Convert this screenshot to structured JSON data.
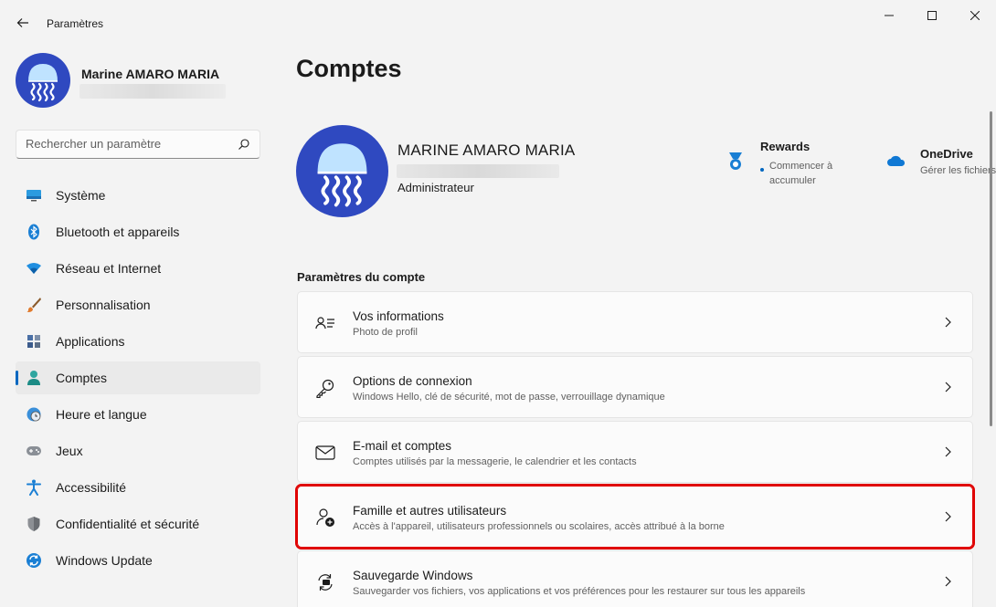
{
  "app": {
    "title": "Paramètres"
  },
  "user": {
    "name": "Marine AMARO MARIA"
  },
  "search": {
    "placeholder": "Rechercher un paramètre"
  },
  "nav": {
    "items": [
      {
        "label": "Système",
        "icon": "monitor-icon"
      },
      {
        "label": "Bluetooth et appareils",
        "icon": "bluetooth-icon"
      },
      {
        "label": "Réseau et Internet",
        "icon": "wifi-icon"
      },
      {
        "label": "Personnalisation",
        "icon": "paintbrush-icon"
      },
      {
        "label": "Applications",
        "icon": "apps-icon"
      },
      {
        "label": "Comptes",
        "icon": "person-icon",
        "active": true
      },
      {
        "label": "Heure et langue",
        "icon": "globe-clock-icon"
      },
      {
        "label": "Jeux",
        "icon": "gamepad-icon"
      },
      {
        "label": "Accessibilité",
        "icon": "accessibility-icon"
      },
      {
        "label": "Confidentialité et sécurité",
        "icon": "shield-icon"
      },
      {
        "label": "Windows Update",
        "icon": "update-icon"
      }
    ]
  },
  "main": {
    "title": "Comptes",
    "profile": {
      "name": "MARINE AMARO MARIA",
      "role": "Administrateur"
    },
    "rewards": {
      "title": "Rewards",
      "subtitle": "Commencer à accumuler"
    },
    "onedrive": {
      "title": "OneDrive",
      "subtitle": "Gérer les fichiers"
    },
    "section_title": "Paramètres du compte",
    "cards": [
      {
        "title": "Vos informations",
        "subtitle": "Photo de profil",
        "icon": "contact-card-icon"
      },
      {
        "title": "Options de connexion",
        "subtitle": "Windows Hello, clé de sécurité, mot de passe, verrouillage dynamique",
        "icon": "key-icon"
      },
      {
        "title": "E-mail et comptes",
        "subtitle": "Comptes utilisés par la messagerie, le calendrier et les contacts",
        "icon": "mail-icon"
      },
      {
        "title": "Famille et autres utilisateurs",
        "subtitle": "Accès à l'appareil, utilisateurs professionnels ou scolaires, accès attribué à la borne",
        "icon": "add-person-icon",
        "highlighted": true
      },
      {
        "title": "Sauvegarde Windows",
        "subtitle": "Sauvegarder vos fichiers, vos applications et vos préférences pour les restaurer sur tous les appareils",
        "icon": "backup-icon"
      }
    ]
  },
  "colors": {
    "accent": "#0067c0",
    "highlight": "#e00000",
    "avatar_bg": "#2f49c0"
  }
}
